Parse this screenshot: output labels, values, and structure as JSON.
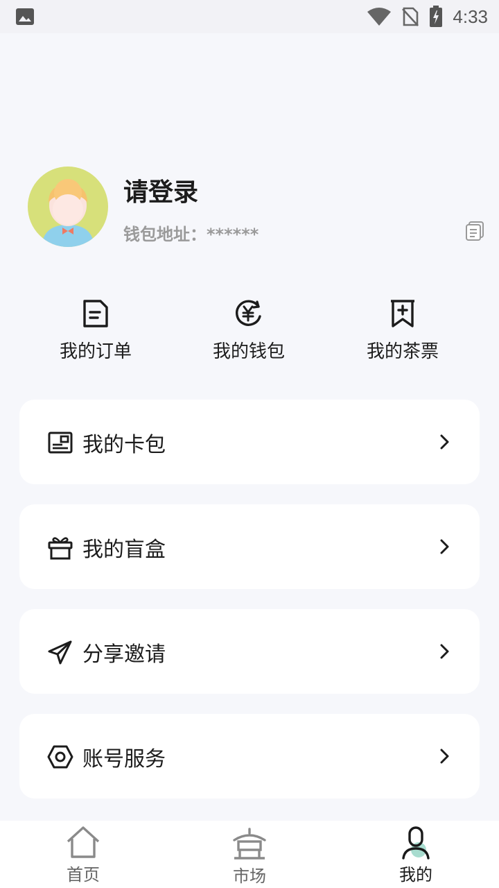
{
  "status_bar": {
    "time": "4:33",
    "icons": [
      "image-icon",
      "wifi-icon",
      "no-sim-icon",
      "battery-charging-icon"
    ]
  },
  "profile": {
    "title": "请登录",
    "wallet_label": "钱包地址：******",
    "avatar": "default-avatar",
    "copy_icon": "copy-icon"
  },
  "quick_actions": [
    {
      "label": "我的订单",
      "icon": "order-document-icon"
    },
    {
      "label": "我的钱包",
      "icon": "yuan-wallet-icon"
    },
    {
      "label": "我的茶票",
      "icon": "bookmark-plus-icon"
    }
  ],
  "menu": [
    {
      "label": "我的卡包",
      "icon": "card-holder-icon"
    },
    {
      "label": "我的盲盒",
      "icon": "gift-box-icon"
    },
    {
      "label": "分享邀请",
      "icon": "paper-plane-icon"
    },
    {
      "label": "账号服务",
      "icon": "hexagon-settings-icon"
    }
  ],
  "tab_bar": {
    "items": [
      {
        "label": "首页",
        "icon": "home-icon",
        "active": false
      },
      {
        "label": "市场",
        "icon": "pavilion-icon",
        "active": false
      },
      {
        "label": "我的",
        "icon": "user-icon",
        "active": true
      }
    ]
  },
  "colors": {
    "background": "#f6f7fb",
    "card": "#ffffff",
    "avatar_bg": "#d7e07a",
    "text_primary": "#1c1c1c",
    "text_secondary": "#9a9a9a",
    "active_accent": "#8fcfc0"
  }
}
